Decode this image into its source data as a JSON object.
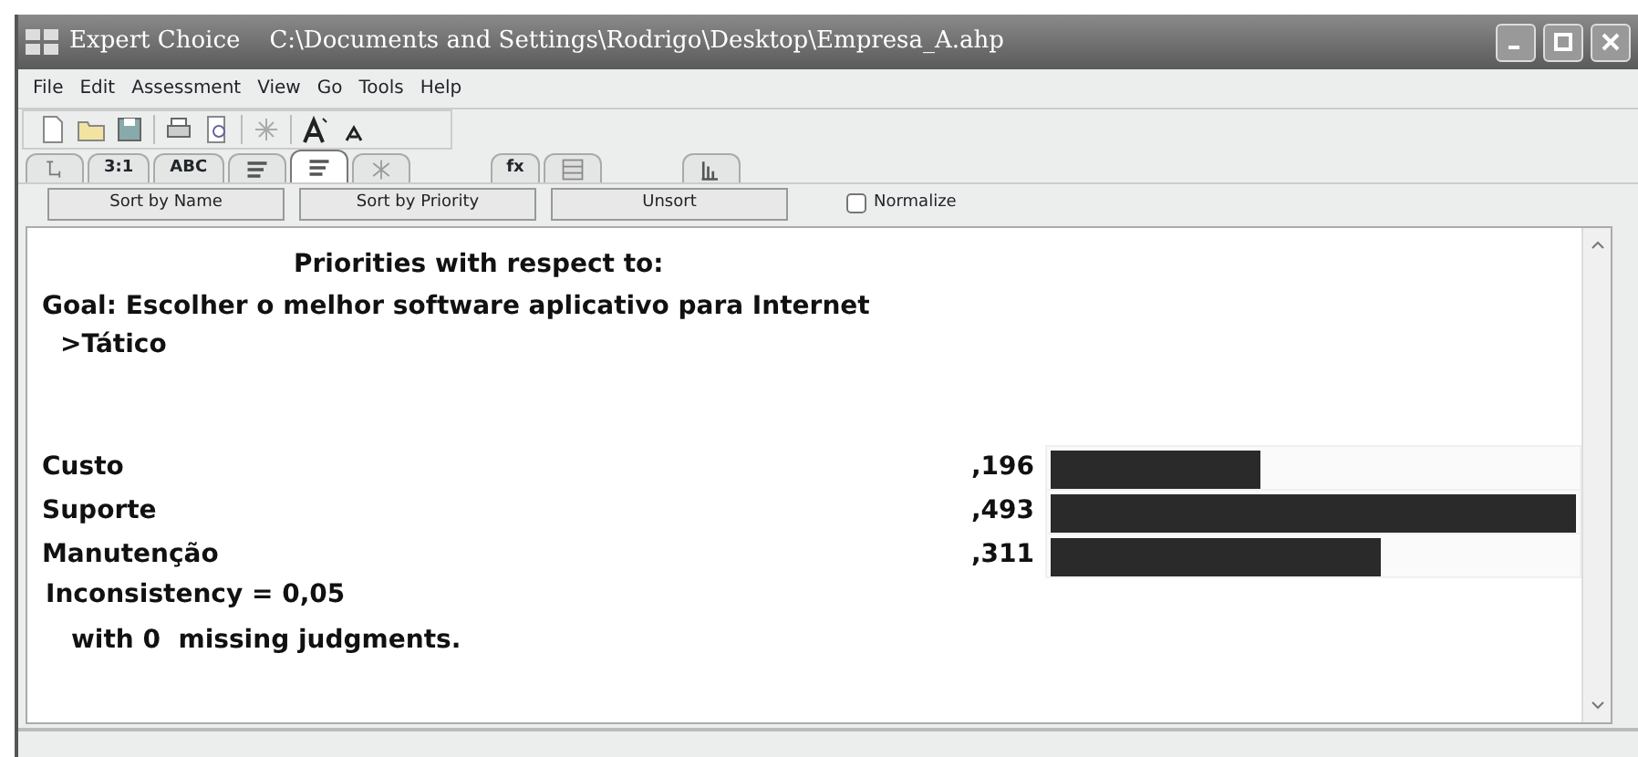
{
  "window": {
    "title": "Expert Choice",
    "path": "C:\\Documents and Settings\\Rodrigo\\Desktop\\Empresa_A.ahp"
  },
  "menu": [
    "File",
    "Edit",
    "Assessment",
    "View",
    "Go",
    "Tools",
    "Help"
  ],
  "toolbar": [
    {
      "kind": "new"
    },
    {
      "kind": "open"
    },
    {
      "kind": "save"
    },
    {
      "kind": "sep"
    },
    {
      "kind": "print"
    },
    {
      "kind": "preview"
    },
    {
      "kind": "sep"
    },
    {
      "kind": "star"
    },
    {
      "kind": "sep"
    },
    {
      "kind": "fontup"
    },
    {
      "kind": "fontdown"
    }
  ],
  "tabs": [
    {
      "kind": "tree",
      "selected": false
    },
    {
      "kind": "text",
      "label": "3:1",
      "selected": false
    },
    {
      "kind": "text",
      "label": "ABC",
      "selected": false
    },
    {
      "kind": "bars",
      "selected": false
    },
    {
      "kind": "bars",
      "selected": true
    },
    {
      "kind": "star",
      "selected": false
    },
    {
      "kind": "gap"
    },
    {
      "kind": "text",
      "label": "fx",
      "selected": false
    },
    {
      "kind": "grid",
      "selected": false
    },
    {
      "kind": "gap"
    },
    {
      "kind": "chart",
      "selected": false
    }
  ],
  "buttons": [
    "Sort by Name",
    "Sort by Priority",
    "Unsort"
  ],
  "normalize": {
    "label": "Normalize",
    "checked": false
  },
  "report": {
    "heading": "Priorities with respect to:",
    "goal": "Goal: Escolher o melhor software aplicativo para Internet",
    "node": ">Tático",
    "rows": [
      {
        "name": "Custo",
        "value": ",196",
        "level": 0.4
      },
      {
        "name": "Suporte",
        "value": ",493",
        "level": 1
      },
      {
        "name": "Manutenção",
        "value": ",311",
        "level": 0.63
      }
    ],
    "inconsistency": "Inconsistency = 0,05",
    "missing": "with 0  missing judgments."
  }
}
